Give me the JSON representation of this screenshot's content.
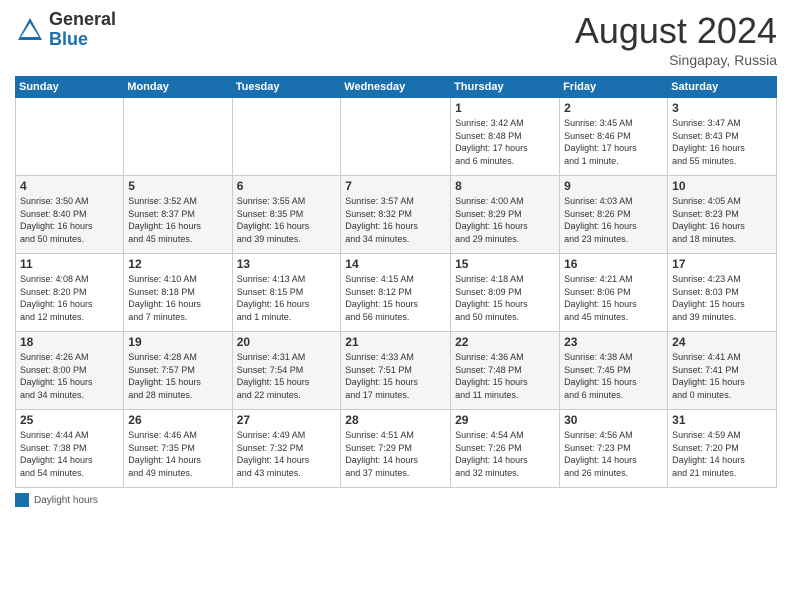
{
  "header": {
    "logo_general": "General",
    "logo_blue": "Blue",
    "month": "August 2024",
    "location": "Singapay, Russia"
  },
  "days_of_week": [
    "Sunday",
    "Monday",
    "Tuesday",
    "Wednesday",
    "Thursday",
    "Friday",
    "Saturday"
  ],
  "weeks": [
    [
      {
        "day": "",
        "info": ""
      },
      {
        "day": "",
        "info": ""
      },
      {
        "day": "",
        "info": ""
      },
      {
        "day": "",
        "info": ""
      },
      {
        "day": "1",
        "info": "Sunrise: 3:42 AM\nSunset: 8:48 PM\nDaylight: 17 hours\nand 6 minutes."
      },
      {
        "day": "2",
        "info": "Sunrise: 3:45 AM\nSunset: 8:46 PM\nDaylight: 17 hours\nand 1 minute."
      },
      {
        "day": "3",
        "info": "Sunrise: 3:47 AM\nSunset: 8:43 PM\nDaylight: 16 hours\nand 55 minutes."
      }
    ],
    [
      {
        "day": "4",
        "info": "Sunrise: 3:50 AM\nSunset: 8:40 PM\nDaylight: 16 hours\nand 50 minutes."
      },
      {
        "day": "5",
        "info": "Sunrise: 3:52 AM\nSunset: 8:37 PM\nDaylight: 16 hours\nand 45 minutes."
      },
      {
        "day": "6",
        "info": "Sunrise: 3:55 AM\nSunset: 8:35 PM\nDaylight: 16 hours\nand 39 minutes."
      },
      {
        "day": "7",
        "info": "Sunrise: 3:57 AM\nSunset: 8:32 PM\nDaylight: 16 hours\nand 34 minutes."
      },
      {
        "day": "8",
        "info": "Sunrise: 4:00 AM\nSunset: 8:29 PM\nDaylight: 16 hours\nand 29 minutes."
      },
      {
        "day": "9",
        "info": "Sunrise: 4:03 AM\nSunset: 8:26 PM\nDaylight: 16 hours\nand 23 minutes."
      },
      {
        "day": "10",
        "info": "Sunrise: 4:05 AM\nSunset: 8:23 PM\nDaylight: 16 hours\nand 18 minutes."
      }
    ],
    [
      {
        "day": "11",
        "info": "Sunrise: 4:08 AM\nSunset: 8:20 PM\nDaylight: 16 hours\nand 12 minutes."
      },
      {
        "day": "12",
        "info": "Sunrise: 4:10 AM\nSunset: 8:18 PM\nDaylight: 16 hours\nand 7 minutes."
      },
      {
        "day": "13",
        "info": "Sunrise: 4:13 AM\nSunset: 8:15 PM\nDaylight: 16 hours\nand 1 minute."
      },
      {
        "day": "14",
        "info": "Sunrise: 4:15 AM\nSunset: 8:12 PM\nDaylight: 15 hours\nand 56 minutes."
      },
      {
        "day": "15",
        "info": "Sunrise: 4:18 AM\nSunset: 8:09 PM\nDaylight: 15 hours\nand 50 minutes."
      },
      {
        "day": "16",
        "info": "Sunrise: 4:21 AM\nSunset: 8:06 PM\nDaylight: 15 hours\nand 45 minutes."
      },
      {
        "day": "17",
        "info": "Sunrise: 4:23 AM\nSunset: 8:03 PM\nDaylight: 15 hours\nand 39 minutes."
      }
    ],
    [
      {
        "day": "18",
        "info": "Sunrise: 4:26 AM\nSunset: 8:00 PM\nDaylight: 15 hours\nand 34 minutes."
      },
      {
        "day": "19",
        "info": "Sunrise: 4:28 AM\nSunset: 7:57 PM\nDaylight: 15 hours\nand 28 minutes."
      },
      {
        "day": "20",
        "info": "Sunrise: 4:31 AM\nSunset: 7:54 PM\nDaylight: 15 hours\nand 22 minutes."
      },
      {
        "day": "21",
        "info": "Sunrise: 4:33 AM\nSunset: 7:51 PM\nDaylight: 15 hours\nand 17 minutes."
      },
      {
        "day": "22",
        "info": "Sunrise: 4:36 AM\nSunset: 7:48 PM\nDaylight: 15 hours\nand 11 minutes."
      },
      {
        "day": "23",
        "info": "Sunrise: 4:38 AM\nSunset: 7:45 PM\nDaylight: 15 hours\nand 6 minutes."
      },
      {
        "day": "24",
        "info": "Sunrise: 4:41 AM\nSunset: 7:41 PM\nDaylight: 15 hours\nand 0 minutes."
      }
    ],
    [
      {
        "day": "25",
        "info": "Sunrise: 4:44 AM\nSunset: 7:38 PM\nDaylight: 14 hours\nand 54 minutes."
      },
      {
        "day": "26",
        "info": "Sunrise: 4:46 AM\nSunset: 7:35 PM\nDaylight: 14 hours\nand 49 minutes."
      },
      {
        "day": "27",
        "info": "Sunrise: 4:49 AM\nSunset: 7:32 PM\nDaylight: 14 hours\nand 43 minutes."
      },
      {
        "day": "28",
        "info": "Sunrise: 4:51 AM\nSunset: 7:29 PM\nDaylight: 14 hours\nand 37 minutes."
      },
      {
        "day": "29",
        "info": "Sunrise: 4:54 AM\nSunset: 7:26 PM\nDaylight: 14 hours\nand 32 minutes."
      },
      {
        "day": "30",
        "info": "Sunrise: 4:56 AM\nSunset: 7:23 PM\nDaylight: 14 hours\nand 26 minutes."
      },
      {
        "day": "31",
        "info": "Sunrise: 4:59 AM\nSunset: 7:20 PM\nDaylight: 14 hours\nand 21 minutes."
      }
    ]
  ],
  "legend": {
    "label": "Daylight hours"
  }
}
